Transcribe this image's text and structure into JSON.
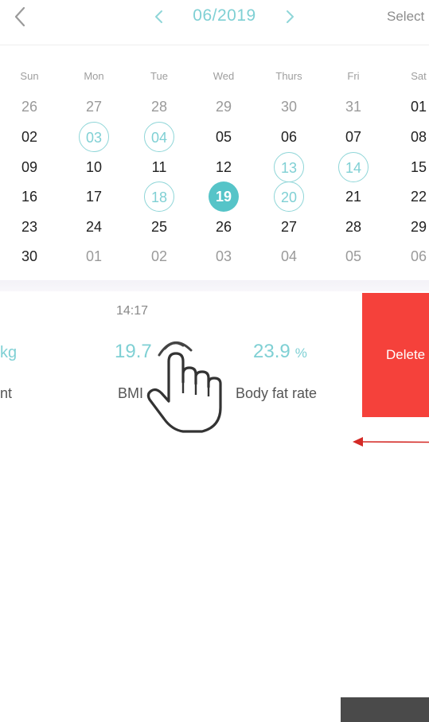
{
  "header": {
    "month": "06/2019",
    "select_label": "Select"
  },
  "calendar": {
    "weekdays": [
      "Sun",
      "Mon",
      "Tue",
      "Wed",
      "Thurs",
      "Fri",
      "Sat"
    ],
    "weeks": [
      [
        {
          "d": "26",
          "s": "muted"
        },
        {
          "d": "27",
          "s": "muted"
        },
        {
          "d": "28",
          "s": "muted"
        },
        {
          "d": "29",
          "s": "muted"
        },
        {
          "d": "30",
          "s": "muted"
        },
        {
          "d": "31",
          "s": "muted"
        },
        {
          "d": "01",
          "s": "normal"
        }
      ],
      [
        {
          "d": "02",
          "s": "normal"
        },
        {
          "d": "03",
          "s": "marked"
        },
        {
          "d": "04",
          "s": "marked"
        },
        {
          "d": "05",
          "s": "normal"
        },
        {
          "d": "06",
          "s": "normal"
        },
        {
          "d": "07",
          "s": "normal"
        },
        {
          "d": "08",
          "s": "normal"
        }
      ],
      [
        {
          "d": "09",
          "s": "normal"
        },
        {
          "d": "10",
          "s": "normal"
        },
        {
          "d": "11",
          "s": "normal"
        },
        {
          "d": "12",
          "s": "normal"
        },
        {
          "d": "13",
          "s": "marked"
        },
        {
          "d": "14",
          "s": "marked"
        },
        {
          "d": "15",
          "s": "normal"
        }
      ],
      [
        {
          "d": "16",
          "s": "normal"
        },
        {
          "d": "17",
          "s": "normal"
        },
        {
          "d": "18",
          "s": "marked"
        },
        {
          "d": "19",
          "s": "selected"
        },
        {
          "d": "20",
          "s": "marked"
        },
        {
          "d": "21",
          "s": "normal"
        },
        {
          "d": "22",
          "s": "normal"
        }
      ],
      [
        {
          "d": "23",
          "s": "normal"
        },
        {
          "d": "24",
          "s": "normal"
        },
        {
          "d": "25",
          "s": "normal"
        },
        {
          "d": "26",
          "s": "normal"
        },
        {
          "d": "27",
          "s": "normal"
        },
        {
          "d": "28",
          "s": "normal"
        },
        {
          "d": "29",
          "s": "normal"
        }
      ],
      [
        {
          "d": "30",
          "s": "normal"
        },
        {
          "d": "01",
          "s": "muted"
        },
        {
          "d": "02",
          "s": "muted"
        },
        {
          "d": "03",
          "s": "muted"
        },
        {
          "d": "04",
          "s": "muted"
        },
        {
          "d": "05",
          "s": "muted"
        },
        {
          "d": "06",
          "s": "muted"
        }
      ]
    ]
  },
  "record": {
    "time": "14:17",
    "weight_unit": "kg",
    "weight_label": "nt",
    "bmi_value": "19.7",
    "bmi_label": "BMI",
    "body_fat_value": "23.9",
    "body_fat_unit": "%",
    "body_fat_label": "Body fat rate",
    "delete_label": "Delete"
  },
  "icons": {
    "back": "chevron-left-icon",
    "prev_month": "chevron-left-icon",
    "next_month": "chevron-right-icon",
    "gesture": "hand-pointer-icon",
    "swipe": "arrow-left-icon"
  },
  "colors": {
    "accent": "#7fd0d4",
    "selected_day": "#56c4c8",
    "delete": "#f5413b",
    "swipe_arrow": "#d42a26"
  }
}
